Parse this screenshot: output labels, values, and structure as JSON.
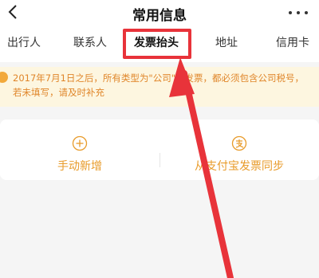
{
  "header": {
    "title": "常用信息"
  },
  "tabs": [
    {
      "label": "出行人"
    },
    {
      "label": "联系人"
    },
    {
      "label": "发票抬头"
    },
    {
      "label": "地址"
    },
    {
      "label": "信用卡"
    }
  ],
  "notice": {
    "text": "2017年7月1日之后，所有类型为\"公司\"的发票，都必须包含公司税号，若未填写，请及时补充"
  },
  "actions": {
    "manual_add": "手动新增",
    "sync_alipay": "从支付宝发票同步"
  },
  "colors": {
    "accent_orange": "#e89b2a",
    "highlight_red": "#e8333a",
    "notice_bg": "#fdf6e0"
  }
}
